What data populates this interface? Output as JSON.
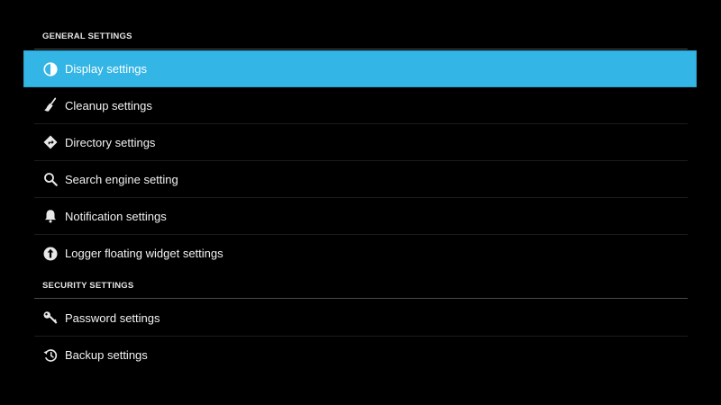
{
  "sections": [
    {
      "title": "GENERAL SETTINGS",
      "items": [
        {
          "label": "Display settings",
          "icon": "display-icon",
          "selected": true
        },
        {
          "label": "Cleanup settings",
          "icon": "broom-icon"
        },
        {
          "label": "Directory settings",
          "icon": "directions-icon"
        },
        {
          "label": "Search engine setting",
          "icon": "search-icon"
        },
        {
          "label": "Notification settings",
          "icon": "bell-icon"
        },
        {
          "label": "Logger floating widget settings",
          "icon": "floating-widget-icon"
        }
      ]
    },
    {
      "title": "SECURITY SETTINGS",
      "items": [
        {
          "label": "Password settings",
          "icon": "key-icon"
        },
        {
          "label": "Backup settings",
          "icon": "history-icon"
        }
      ]
    }
  ],
  "colors": {
    "background": "#000000",
    "selected_row": "#33b5e5",
    "text": "#f2f2f2",
    "divider": "#4a4a4a"
  }
}
